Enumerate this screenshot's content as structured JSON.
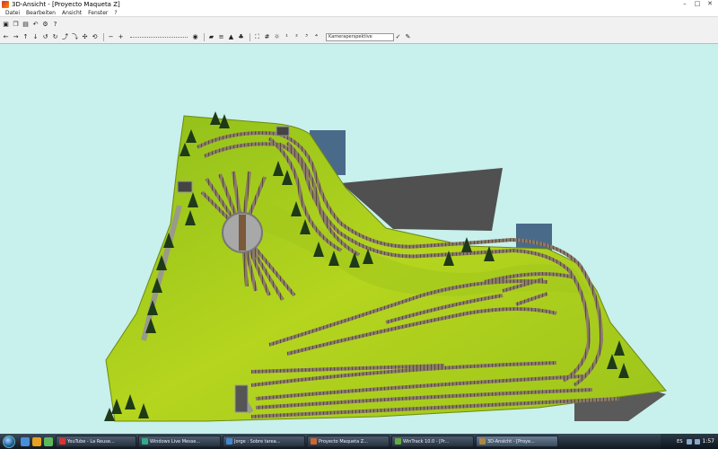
{
  "window": {
    "title": "3D-Ansicht - [Proyecto Maqueta Z]",
    "controls": {
      "minimize": "–",
      "maximize": "□",
      "close": "✕"
    }
  },
  "menu": {
    "items": [
      "Datei",
      "Bearbeiten",
      "Ansicht",
      "Fenster",
      "?"
    ]
  },
  "toolbar": {
    "row1_icons": [
      "save-icon",
      "copy-icon",
      "print-icon",
      "undo-icon",
      "settings-icon",
      "help-icon"
    ],
    "view_select": "Kameraperspektive"
  },
  "taskbar": {
    "buttons": [
      {
        "label": "YouTube - La Reuse...",
        "color": "#d33"
      },
      {
        "label": "Windows Live Messe...",
        "color": "#3a8"
      },
      {
        "label": "Jorge : Sobre tarea...",
        "color": "#48c"
      },
      {
        "label": "Proyecto Maqueta Z...",
        "color": "#c63"
      },
      {
        "label": "WinTrack 10.0 - [Pr...",
        "color": "#6a4"
      },
      {
        "label": "3D-Ansicht - [Proye...",
        "color": "#a84"
      }
    ],
    "tray": {
      "lang": "ES",
      "clock": "1:57"
    },
    "quick_launch_colors": [
      "#4a8ed8",
      "#e8a020",
      "#5cb85c"
    ]
  }
}
